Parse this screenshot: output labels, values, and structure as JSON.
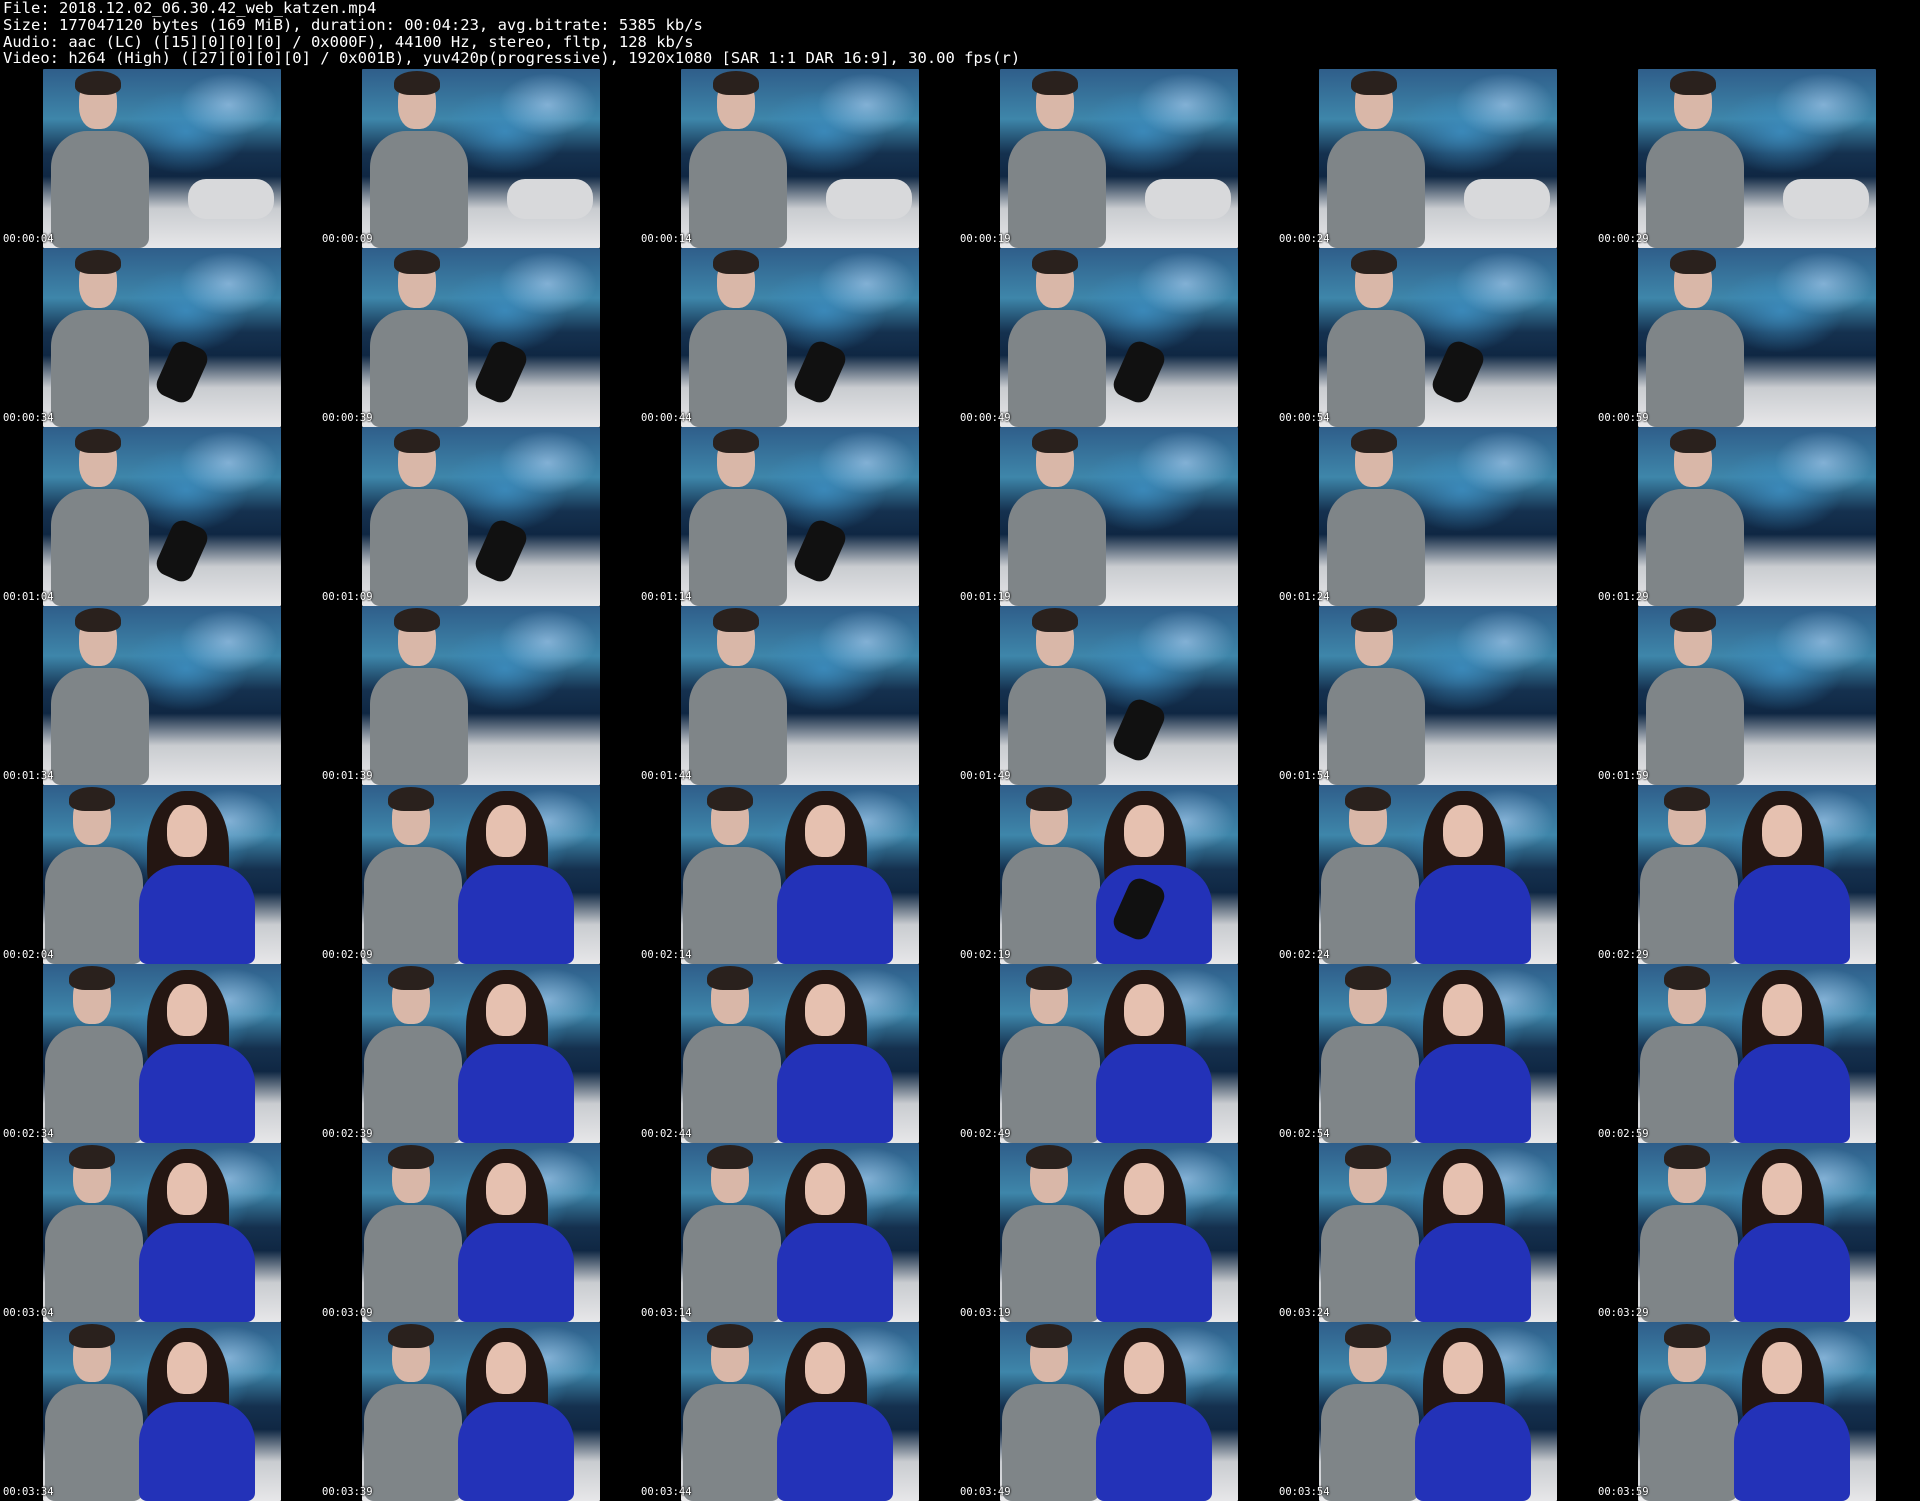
{
  "header": {
    "line1": "File: 2018.12.02_06.30.42_web_katzen.mp4",
    "line2": "Size: 177047120 bytes (169 MiB), duration: 00:04:23, avg.bitrate: 5385 kb/s",
    "line3": "Audio: aac (LC) ([15][0][0][0] / 0x000F), 44100 Hz, stereo, fltp, 128 kb/s",
    "line4": "Video: h264 (High) ([27][0][0][0] / 0x001B), yuv420p(progressive), 1920x1080 [SAR 1:1 DAR 16:9], 30.00 fps(r)"
  },
  "colors": {
    "background": "#000000",
    "text": "#ffffff"
  },
  "grid": {
    "columns": 6,
    "rows": 8,
    "timestamps": [
      "00:00:04",
      "00:00:09",
      "00:00:14",
      "00:00:19",
      "00:00:24",
      "00:00:29",
      "00:00:34",
      "00:00:39",
      "00:00:44",
      "00:00:49",
      "00:00:54",
      "00:00:59",
      "00:01:04",
      "00:01:09",
      "00:01:14",
      "00:01:19",
      "00:01:24",
      "00:01:29",
      "00:01:34",
      "00:01:39",
      "00:01:44",
      "00:01:49",
      "00:01:54",
      "00:01:59",
      "00:02:04",
      "00:02:09",
      "00:02:14",
      "00:02:19",
      "00:02:24",
      "00:02:29",
      "00:02:34",
      "00:02:39",
      "00:02:44",
      "00:02:49",
      "00:02:54",
      "00:02:59",
      "00:03:04",
      "00:03:09",
      "00:03:14",
      "00:03:19",
      "00:03:24",
      "00:03:29",
      "00:03:34",
      "00:03:39",
      "00:03:44",
      "00:03:49",
      "00:03:54",
      "00:03:59"
    ],
    "two_person_from_index": 24,
    "legs_visible_indices": [
      0,
      1,
      2,
      3,
      4,
      5
    ],
    "socks_visible_indices": [
      6,
      7,
      8,
      9,
      10,
      12,
      13,
      14,
      21,
      27
    ]
  }
}
